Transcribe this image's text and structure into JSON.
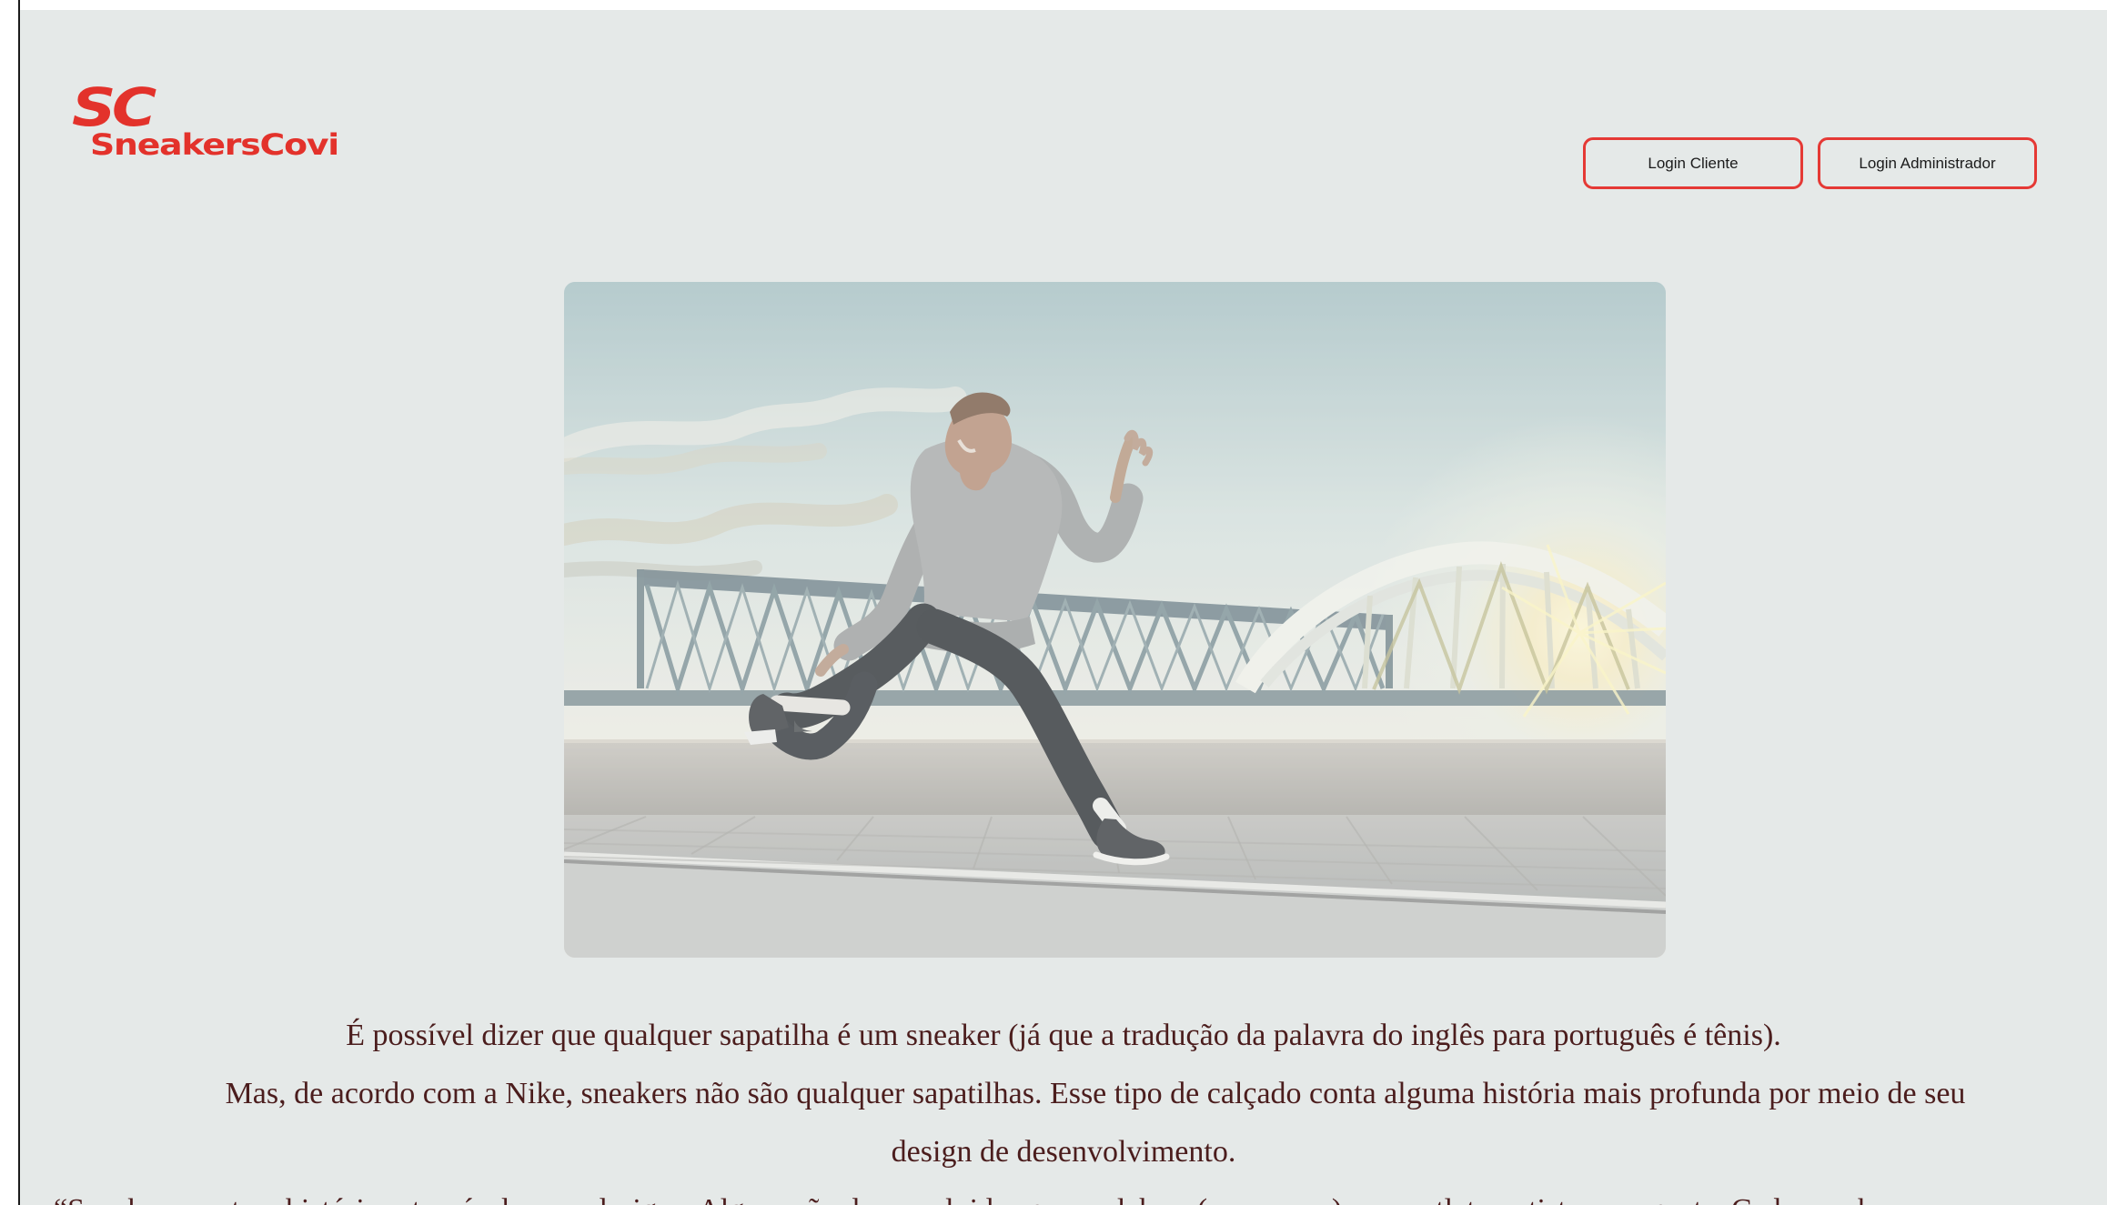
{
  "brand": {
    "mark": "SC",
    "name": "SneakersCovi",
    "color": "#e3322b"
  },
  "nav": {
    "buttons": [
      "Login Cliente",
      "Login Administrador"
    ],
    "button_border_color": "#e53935"
  },
  "hero": {
    "image_name": "runner-by-bridge-image"
  },
  "content": {
    "paragraph_lines": [
      "É possível dizer que qualquer sapatilha é um sneaker (já que a tradução da palavra do inglês para português é tênis).",
      "Mas, de acordo com a Nike, sneakers não são qualquer sapatilhas. Esse tipo de calçado conta alguma história mais profunda por meio de seu",
      "design de desenvolvimento.",
      "“Sneakers contam histórias através de seus designs. Alguns são desenvolvidos para celebrar (ou marcar) o seu atleta, artista ou esporte. Cada sneaker"
    ]
  },
  "colors": {
    "page_background": "#e5e9e8",
    "text": "#4b1d1d",
    "accent": "#e53935"
  }
}
